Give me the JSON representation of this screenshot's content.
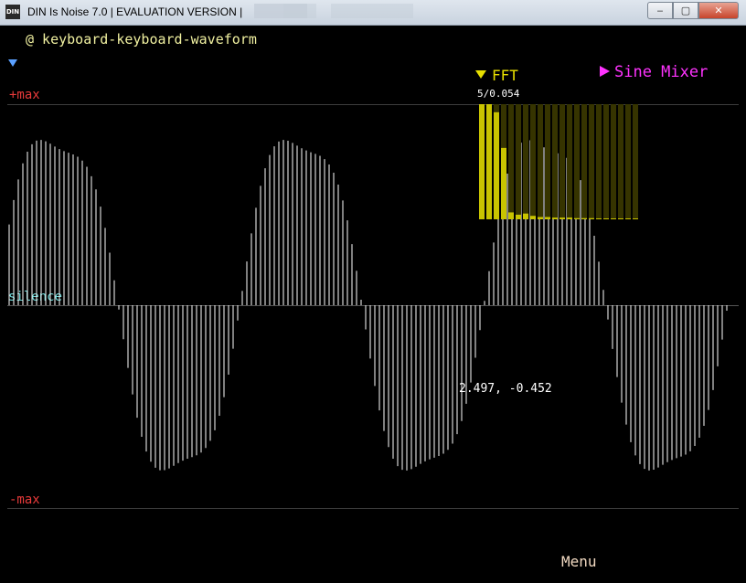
{
  "window": {
    "title": "DIN Is Noise 7.0 | EVALUATION VERSION |",
    "icon_name": "din-app-icon",
    "controls": {
      "minimize": "‒",
      "maximize": "▢",
      "close": "✕"
    }
  },
  "editor": {
    "name": "@ keyboard-keyboard-waveform",
    "expand_icon": "triangle-down-icon",
    "top_label": "+max",
    "mid_label": "silence",
    "bottom_label": "-max",
    "cursor_readout": "2.497, -0.452",
    "menu": "Menu"
  },
  "fft": {
    "label": "FFT",
    "readout": "5/0.054",
    "expanded": true,
    "bars": [
      1.0,
      1.0,
      0.93,
      0.62,
      0.06,
      0.04,
      0.05,
      0.03,
      0.02,
      0.02,
      0.015,
      0.015,
      0.015,
      0.01,
      0.01,
      0.01,
      0.0,
      0.0,
      0.0,
      0.0,
      0.0,
      0.0
    ]
  },
  "sine_mixer": {
    "label": "Sine Mixer"
  },
  "colors": {
    "editor_name": "#f0f0a0",
    "max_labels": "#e83a3a",
    "silence": "#6ad3d3",
    "fft": "#e8e000",
    "fft_bar": "#c9c400",
    "fft_bg": "#363400",
    "sine_mixer": "#ff33ff",
    "waveform": "#ffffff",
    "menu": "#f0d8c0",
    "expand_icon": "#5aa0ff"
  }
}
